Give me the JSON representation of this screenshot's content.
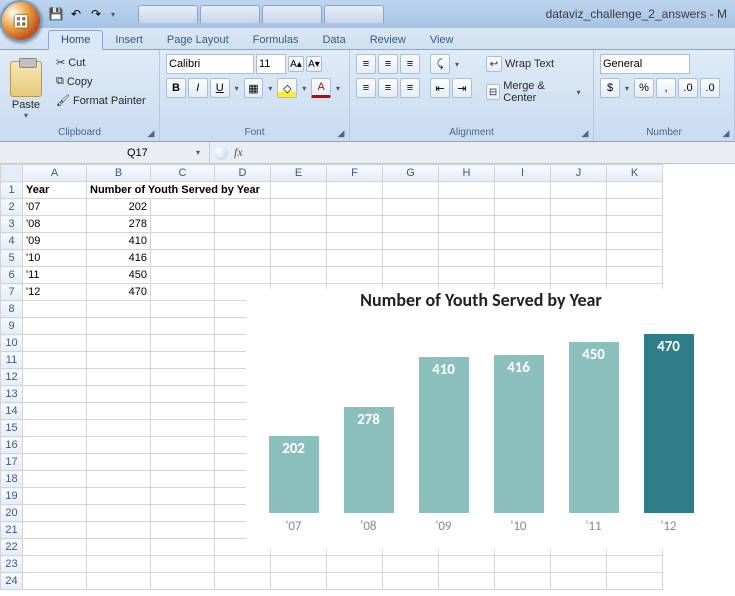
{
  "title": "dataviz_challenge_2_answers - M",
  "qat": {
    "save": "💾",
    "undo": "↶",
    "redo": "↷"
  },
  "tabs": [
    "Home",
    "Insert",
    "Page Layout",
    "Formulas",
    "Data",
    "Review",
    "View"
  ],
  "active_tab": "Home",
  "clipboard": {
    "paste": "Paste",
    "cut": "Cut",
    "copy": "Copy",
    "format_painter": "Format Painter",
    "group": "Clipboard"
  },
  "font": {
    "name": "Calibri",
    "size": "11",
    "bold": "B",
    "italic": "I",
    "underline": "U",
    "group": "Font"
  },
  "alignment": {
    "wrap": "Wrap Text",
    "merge": "Merge & Center",
    "group": "Alignment"
  },
  "number": {
    "format": "General",
    "group": "Number"
  },
  "cell_ref": "Q17",
  "formula": "",
  "columns": [
    "A",
    "B",
    "C",
    "D",
    "E",
    "F",
    "G",
    "H",
    "I",
    "J",
    "K"
  ],
  "header": {
    "A": "Year",
    "B": "Number of Youth Served by Year"
  },
  "rows": [
    {
      "A": "'07",
      "B": "202"
    },
    {
      "A": "'08",
      "B": "278"
    },
    {
      "A": "'09",
      "B": "410"
    },
    {
      "A": "'10",
      "B": "416"
    },
    {
      "A": "'11",
      "B": "450"
    },
    {
      "A": "'12",
      "B": "470"
    }
  ],
  "chart_data": {
    "type": "bar",
    "title": "Number of Youth Served by Year",
    "categories": [
      "'07",
      "'08",
      "'09",
      "'10",
      "'11",
      "'12"
    ],
    "values": [
      202,
      278,
      410,
      416,
      450,
      470
    ],
    "highlight_index": 5,
    "ylim": [
      0,
      500
    ],
    "xlabel": "",
    "ylabel": ""
  }
}
